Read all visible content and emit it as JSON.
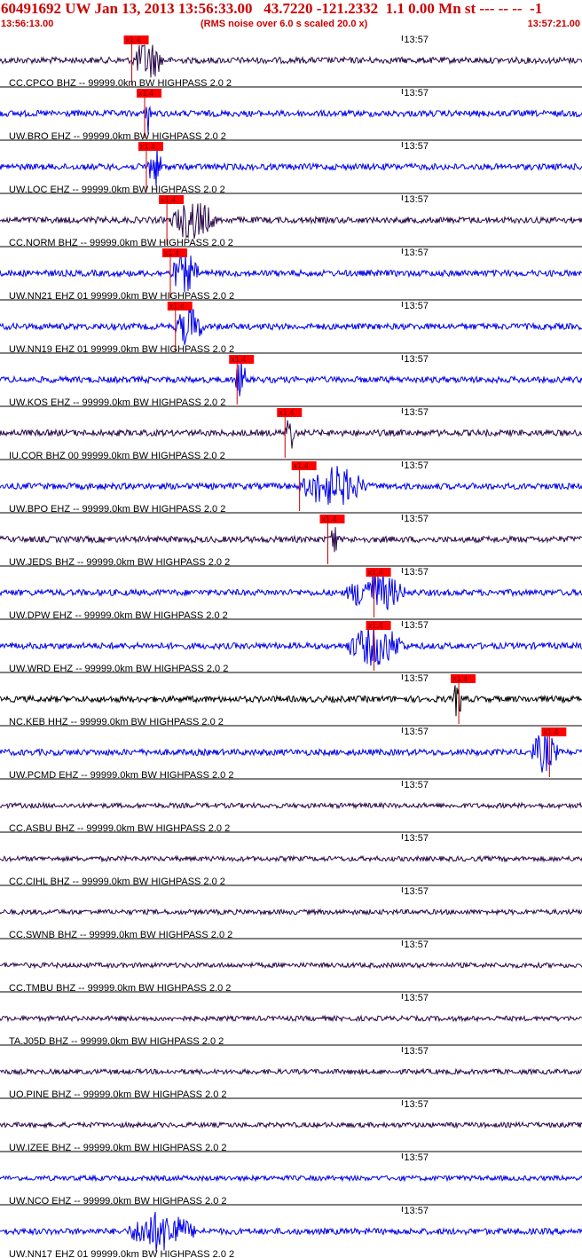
{
  "header": {
    "title": "60491692 UW Jan 13, 2013 13:56:33.00   43.7220 -121.2332  1.1 0.00 Mn st --- -- --  -1",
    "start_time": "13:56:13.00",
    "scale_note": "(RMS noise over 6.0 s scaled 20.0 x)",
    "end_time": "13:57:21.00"
  },
  "colors": {
    "header_text": "#cc0000",
    "pick_box": "#ff0000",
    "pick_line": "#cc0000",
    "trace_blue": "#0000ee",
    "trace_purple": "#2a0a4a",
    "trace_black": "#000000"
  },
  "chart_data": {
    "type": "line",
    "x_axis": {
      "start": "13:56:13.00",
      "end": "13:57:21.00",
      "tick_label": "13:57"
    },
    "pick_label": "x1.4",
    "traces": [
      {
        "station": "CC.CPCO BHZ -- 99999.0km BW  HIGHPASS  2.0  2",
        "color": "#2a0a4a",
        "pick": "13:56:28.4",
        "burst": [
          "13:56:28.5",
          "13:56:34.0"
        ]
      },
      {
        "station": "UW.BRO EHZ -- 99999.0km BW  HIGHPASS  2.0  2",
        "color": "#0000ee",
        "pick": "13:56:29.9",
        "burst": [
          "13:56:30.0",
          "13:56:31.0"
        ]
      },
      {
        "station": "UW.LOC EHZ -- 99999.0km BW  HIGHPASS  2.0  2",
        "color": "#0000ee",
        "pick": "13:56:30.1",
        "burst": [
          "13:56:30.2",
          "13:56:33.0"
        ]
      },
      {
        "station": "CC.NORM BHZ -- 99999.0km BW  HIGHPASS  2.0  2",
        "color": "#2a0a4a",
        "pick": "13:56:32.5",
        "burst": [
          "13:56:33.0",
          "13:56:41.0"
        ]
      },
      {
        "station": "UW.NN21 EHZ 01 99999.0km BW  HIGHPASS  2.0  2",
        "color": "#0000ee",
        "pick": "13:56:32.9",
        "burst": [
          "13:56:33.0",
          "13:56:38.0"
        ]
      },
      {
        "station": "UW.NN19 EHZ 01 99999.0km BW  HIGHPASS  2.0  2",
        "color": "#0000ee",
        "pick": "13:56:33.5",
        "burst": [
          "13:56:33.5",
          "13:56:38.5"
        ]
      },
      {
        "station": "UW.KOS EHZ -- 99999.0km BW  HIGHPASS  2.0  2",
        "color": "#0000ee",
        "pick": "13:56:40.7",
        "burst": [
          "13:56:40.5",
          "13:56:42.5"
        ]
      },
      {
        "station": "IU.COR BHZ 00 99999.0km BW  HIGHPASS  2.0  2",
        "color": "#2a0a4a",
        "pick": "13:56:46.3",
        "burst": [
          "13:56:46.3",
          "13:56:48.0"
        ]
      },
      {
        "station": "UW.BPO EHZ -- 99999.0km BW  HIGHPASS  2.0  2",
        "color": "#0000ee",
        "pick": "13:56:48.0",
        "burst": [
          "13:56:48.0",
          "13:57:00.0"
        ]
      },
      {
        "station": "UW.JEDS BHZ -- 99999.0km BW  HIGHPASS  2.0  2",
        "color": "#2a0a4a",
        "pick": "13:56:51.3",
        "burst": [
          "13:56:51.5",
          "13:56:53.0"
        ]
      },
      {
        "station": "UW.DPW EHZ -- 99999.0km BW  HIGHPASS  2.0  2",
        "color": "#0000ee",
        "pick": "13:56:56.7",
        "burst": [
          "13:56:53.5",
          "13:57:04.0"
        ]
      },
      {
        "station": "UW.WRD EHZ -- 99999.0km BW  HIGHPASS  2.0  2",
        "color": "#0000ee",
        "pick": "13:56:56.7",
        "burst": [
          "13:56:53.5",
          "13:57:04.0"
        ]
      },
      {
        "station": "NC.KEB HHZ -- 99999.0km BW  HIGHPASS  2.0  2",
        "color": "#000000",
        "pick": "13:57:06.6",
        "burst": [
          "13:57:06.0",
          "13:57:07.5"
        ]
      },
      {
        "station": "UW.PCMD EHZ -- 99999.0km BW  HIGHPASS  2.0  2",
        "color": "#0000ee",
        "pick": "13:57:17.2",
        "burst": [
          "13:57:15.0",
          "13:57:20.0"
        ]
      },
      {
        "station": "CC.ASBU BHZ -- 99999.0km BW  HIGHPASS  2.0  2",
        "color": "#2a0a4a",
        "pick": null,
        "burst": null
      },
      {
        "station": "CC.CIHL BHZ -- 99999.0km BW  HIGHPASS  2.0  2",
        "color": "#2a0a4a",
        "pick": null,
        "burst": null
      },
      {
        "station": "CC.SWNB BHZ -- 99999.0km BW  HIGHPASS  2.0  2",
        "color": "#2a0a4a",
        "pick": null,
        "burst": null
      },
      {
        "station": "CC.TMBU BHZ -- 99999.0km BW  HIGHPASS  2.0  2",
        "color": "#2a0a4a",
        "pick": null,
        "burst": null
      },
      {
        "station": "TA.J05D BHZ -- 99999.0km BW  HIGHPASS  2.0  2",
        "color": "#2a0a4a",
        "pick": null,
        "burst": null
      },
      {
        "station": "UO.PINE BHZ -- 99999.0km BW  HIGHPASS  2.0  2",
        "color": "#2a0a4a",
        "pick": null,
        "burst": null
      },
      {
        "station": "UW.IZEE BHZ -- 99999.0km BW  HIGHPASS  2.0  2",
        "color": "#2a0a4a",
        "pick": null,
        "burst": null
      },
      {
        "station": "UW.NCO EHZ -- 99999.0km BW  HIGHPASS  2.0  2",
        "color": "#0000ee",
        "pick": null,
        "burst": null
      },
      {
        "station": "UW.NN17 EHZ 01 99999.0km BW  HIGHPASS  2.0  2",
        "color": "#0000ee",
        "pick": null,
        "burst": [
          "13:56:28.0",
          "13:56:40.0"
        ]
      }
    ]
  }
}
